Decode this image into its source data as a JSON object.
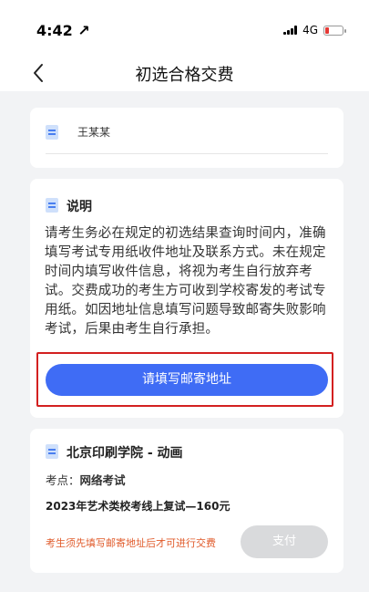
{
  "status_bar": {
    "time": "4:42 ↗",
    "network": "4G"
  },
  "nav": {
    "title": "初选合格交费",
    "back_icon": "chevron-left-icon"
  },
  "name_card": {
    "icon": "document-icon",
    "name": "王某某"
  },
  "notice": {
    "icon": "document-icon",
    "title": "说明",
    "body": "请考生务必在规定的初选结果查询时间内，准确填写考试专用纸收件地址及联系方式。未在规定时间内填写收件信息，将视为考生自行放弃考试。交费成功的考生方可收到学校寄发的考试专用纸。如因地址信息填写问题导致邮寄失败影响考试，后果由考生自行承担。",
    "button_label": "请填写邮寄地址",
    "button_color": "#3f6cf5",
    "highlight_color": "#d32020"
  },
  "exam": {
    "icon": "document-icon",
    "school": "北京印刷学院 - 动画",
    "site_label": "考点：",
    "site_value": "网络考试",
    "fee": "2023年艺术类校考线上复试—160元",
    "warning": "考生须先填写邮寄地址后才可进行交费",
    "warning_color": "#e05a2a",
    "pay_label": "支付",
    "pay_disabled": true
  }
}
